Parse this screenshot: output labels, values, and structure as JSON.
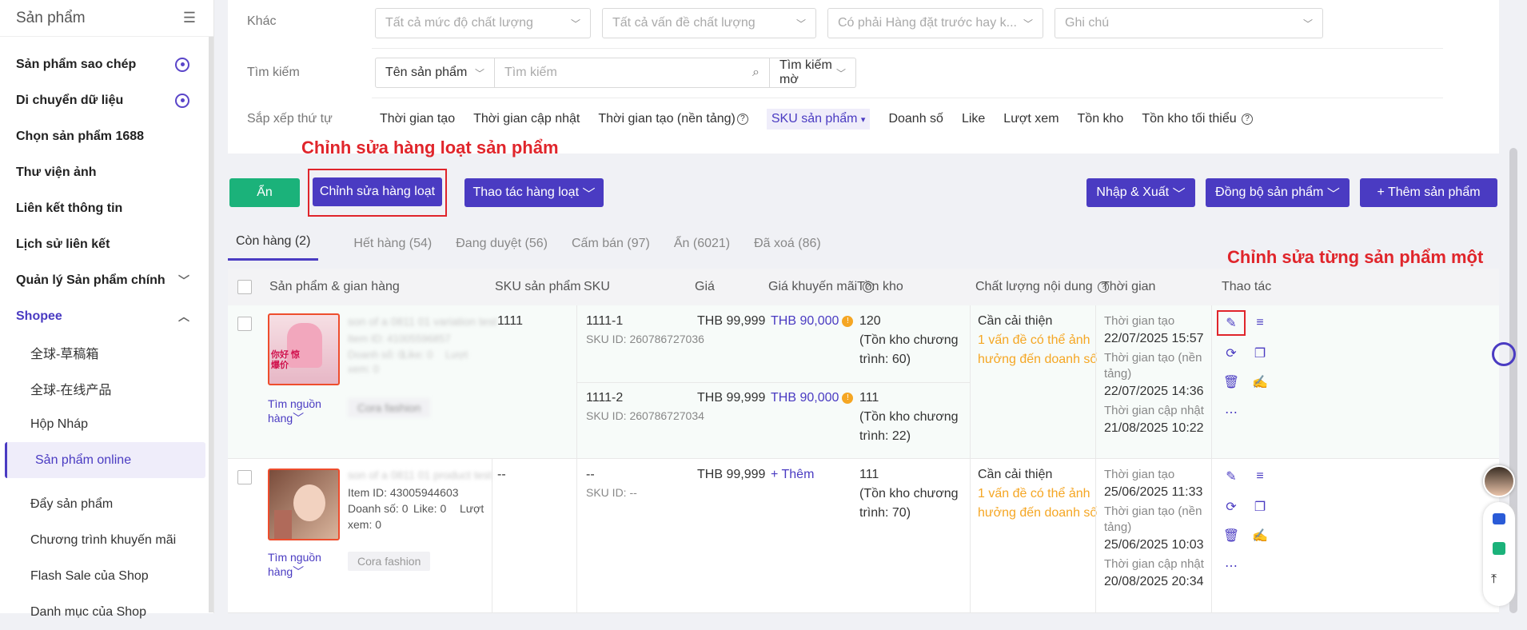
{
  "sidebar": {
    "title": "Sản phẩm",
    "items": [
      {
        "label": "Sản phẩm sao chép"
      },
      {
        "label": "Di chuyển dữ liệu"
      },
      {
        "label": "Chọn sản phẩm 1688"
      },
      {
        "label": "Thư viện ảnh"
      },
      {
        "label": "Liên kết thông tin"
      },
      {
        "label": "Lịch sử liên kết"
      },
      {
        "label": "Quản lý Sản phẩm chính"
      },
      {
        "label": "Shopee"
      }
    ],
    "subitems": [
      {
        "label": "全球-草稿箱"
      },
      {
        "label": "全球-在线产品"
      },
      {
        "label": "Hộp Nháp"
      },
      {
        "label": "Sản phẩm online"
      },
      {
        "label": "Đẩy sản phẩm"
      },
      {
        "label": "Chương trình khuyến mãi"
      },
      {
        "label": "Flash Sale của Shop"
      },
      {
        "label": "Danh mục của Shop"
      }
    ]
  },
  "filters": {
    "other_label": "Khác",
    "quality_level": "Tất cả mức độ chất lượng",
    "quality_issue": "Tất cả vấn đề chất lượng",
    "preorder": "Có phải Hàng đặt trước hay k...",
    "note": "Ghi chú",
    "search_label": "Tìm kiếm",
    "search_field": "Tên sản phẩm",
    "search_placeholder": "Tìm kiếm",
    "search_mode": "Tìm kiếm mờ",
    "sort_label": "Sắp xếp thứ tự",
    "sort_options": [
      "Thời gian tạo",
      "Thời gian cập nhật",
      "Thời gian tạo (nền tảng)",
      "SKU sản phẩm",
      "Doanh số",
      "Like",
      "Lượt xem",
      "Tồn kho",
      "Tồn kho tối thiểu"
    ]
  },
  "annotations": {
    "bulk_edit": "Chỉnh sửa hàng loạt sản phẩm",
    "single_edit": "Chỉnh sửa từng sản phẩm một"
  },
  "toolbar": {
    "hide": "Ẩn",
    "bulk_edit": "Chỉnh sửa hàng loạt",
    "bulk_actions": "Thao tác hàng loạt",
    "import_export": "Nhập & Xuất",
    "sync": "Đồng bộ sản phẩm",
    "add": "+ Thêm sản phẩm"
  },
  "tabs": [
    {
      "label": "Còn hàng",
      "count": "(2)"
    },
    {
      "label": "Hết hàng",
      "count": "(54)"
    },
    {
      "label": "Đang duyệt",
      "count": "(56)"
    },
    {
      "label": "Cấm bán",
      "count": "(97)"
    },
    {
      "label": "Ẩn",
      "count": "(6021)"
    },
    {
      "label": "Đã xoá",
      "count": "(86)"
    }
  ],
  "columns": [
    "Sản phẩm & gian hàng",
    "SKU sản phẩm",
    "SKU",
    "Giá",
    "Giá khuyến mãi",
    "Tồn kho",
    "Chất lượng nội dung",
    "Thời gian",
    "Thao tác"
  ],
  "rows": [
    {
      "name": "son of a 0811 01 variation test",
      "item_id": "Item ID: 41005596857",
      "sales": "Doanh số: 0",
      "likes": "Like: 0",
      "views_a": "Lượt",
      "views_b": "xem: 0",
      "source_a": "Tìm nguồn",
      "source_b": "hàng",
      "shop": "Cora fashion",
      "product_sku": "1111",
      "variants": [
        {
          "sku": "1111-1",
          "sku_id": "SKU ID: 260786727036",
          "price": "THB 99,999",
          "promo": "THB 90,000",
          "stock": "120",
          "stock_note_a": "(Tồn kho chương",
          "stock_note_b": "trình: 60)"
        },
        {
          "sku": "1111-2",
          "sku_id": "SKU ID: 260786727034",
          "price": "THB 99,999",
          "promo": "THB 90,000",
          "stock": "111",
          "stock_note_a": "(Tồn kho chương",
          "stock_note_b": "trình: 22)"
        }
      ],
      "quality": "Cần cải thiện",
      "quality_note_a": "1 vấn đề có thể ảnh",
      "quality_note_b": "hưởng đến doanh số",
      "time_created_label": "Thời gian tạo",
      "time_created": "22/07/2025 15:57",
      "time_platform_label_a": "Thời gian tạo (nền",
      "time_platform_label_b": "tảng)",
      "time_platform": "22/07/2025 14:36",
      "time_updated_label": "Thời gian cập nhật",
      "time_updated": "21/08/2025 10:22"
    },
    {
      "name": "son of a 0811 01 product test",
      "item_id": "Item ID: 43005944603",
      "sales": "Doanh số: 0",
      "likes": "Like: 0",
      "views_a": "Lượt",
      "views_b": "xem: 0",
      "source_a": "Tìm nguồn",
      "source_b": "hàng",
      "shop": "Cora fashion",
      "product_sku": "--",
      "sku": "--",
      "sku_id": "SKU ID: --",
      "price": "THB 99,999",
      "promo": "+ Thêm",
      "stock": "111",
      "stock_note_a": "(Tồn kho chương",
      "stock_note_b": "trình: 70)",
      "quality": "Cần cải thiện",
      "quality_note_a": "1 vấn đề có thể ảnh",
      "quality_note_b": "hưởng đến doanh số",
      "time_created_label": "Thời gian tạo",
      "time_created": "25/06/2025 11:33",
      "time_platform_label_a": "Thời gian tạo (nền",
      "time_platform_label_b": "tảng)",
      "time_platform": "25/06/2025 10:03",
      "time_updated_label": "Thời gian cập nhật",
      "time_updated": "20/08/2025 20:34"
    }
  ],
  "thumb_text": "你好 惊爆价"
}
